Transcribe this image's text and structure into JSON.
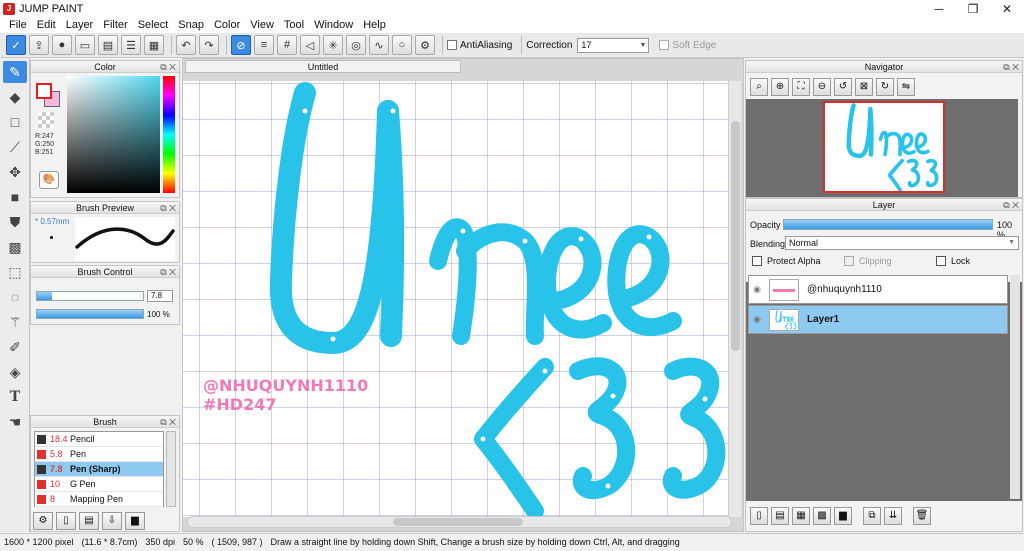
{
  "window": {
    "title": "JUMP PAINT",
    "controls": [
      "─",
      "❐",
      "✕"
    ]
  },
  "menu": [
    "File",
    "Edit",
    "Layer",
    "Filter",
    "Select",
    "Snap",
    "Color",
    "View",
    "Tool",
    "Window",
    "Help"
  ],
  "toolbar": {
    "antialiasing_label": "AntiAliasing",
    "correction_label": "Correction",
    "correction_value": "17",
    "soft_edge_label": "Soft Edge"
  },
  "color_panel": {
    "title": "Color",
    "rgb": [
      "R:247",
      "G:250",
      "B:251"
    ],
    "foreground": "#ffffff",
    "background": "#f7b5e0"
  },
  "brush_preview": {
    "title": "Brush Preview",
    "size": "* 0.57mm"
  },
  "brush_control": {
    "title": "Brush Control",
    "size_value": "7.8",
    "opacity_value": "100 %",
    "opacity_fraction": 1.0
  },
  "brush": {
    "title": "Brush",
    "items": [
      {
        "size": "18.4",
        "name": "Pencil",
        "color": "#333333"
      },
      {
        "size": "5.8",
        "name": "Pen",
        "color": "#e03030"
      },
      {
        "size": "7.8",
        "name": "Pen (Sharp)",
        "color": "#333333"
      },
      {
        "size": "10",
        "name": "G Pen",
        "color": "#e03030"
      },
      {
        "size": "8",
        "name": "Mapping Pen",
        "color": "#e03030"
      }
    ]
  },
  "document": {
    "tab_title": "Untitled",
    "watermark_lines": [
      "@NHUQUYNH1110",
      "#HD247"
    ],
    "stroke_color": "#29c3ea"
  },
  "navigator": {
    "title": "Navigator"
  },
  "layer_panel": {
    "title": "Layer",
    "opacity_label": "Opacity",
    "opacity_value": "100 %",
    "blending_label": "Blending",
    "blending_value": "Normal",
    "protect_alpha": "Protect Alpha",
    "clipping": "Clipping",
    "lock": "Lock",
    "layers": [
      {
        "name": "@nhuquynh1110",
        "selected": false
      },
      {
        "name": "Layer1",
        "selected": true
      }
    ]
  },
  "status": {
    "size": "1600 * 1200 pixel",
    "physical": "(11.6 * 8.7cm)",
    "dpi": "350 dpi",
    "zoom": "50 %",
    "coords": "( 1509, 987 )",
    "hint": "Draw a straight line by holding down Shift, Change a brush size by holding down Ctrl, Alt, and dragging"
  }
}
